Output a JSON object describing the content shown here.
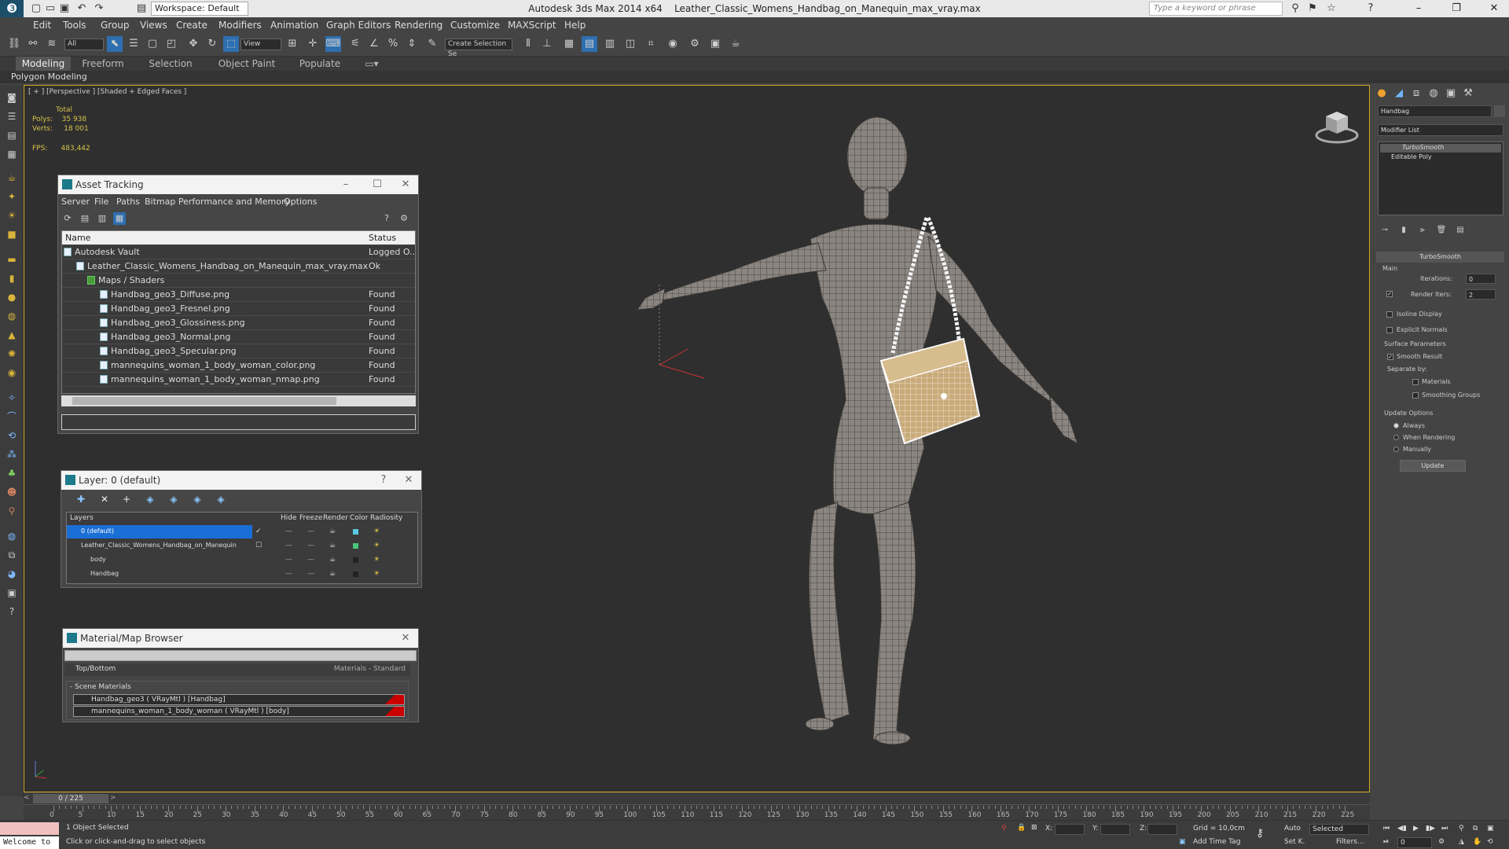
{
  "window": {
    "app_title": "Autodesk 3ds Max  2014 x64",
    "file_title": "Leather_Classic_Womens_Handbag_on_Manequin_max_vray.max",
    "workspace": "Workspace: Default",
    "search_placeholder": "Type a keyword or phrase"
  },
  "menubar": [
    "Edit",
    "Tools",
    "Group",
    "Views",
    "Create",
    "Modifiers",
    "Animation",
    "Graph Editors",
    "Rendering",
    "Customize",
    "MAXScript",
    "Help"
  ],
  "toolbar": {
    "selection_filter": "All",
    "ref_coord": "View",
    "named_selection": "Create Selection Se"
  },
  "ribbon": {
    "tabs": [
      "Modeling",
      "Freeform",
      "Selection",
      "Object Paint",
      "Populate"
    ],
    "sub_label": "Polygon Modeling"
  },
  "viewport": {
    "label": "[ + ] [Perspective ] [Shaded + Edged Faces ]",
    "stats_total": "Total",
    "polys_label": "Polys:",
    "polys_value": "35 938",
    "verts_label": "Verts:",
    "verts_value": "18 001",
    "fps_label": "FPS:",
    "fps_value": "483,442"
  },
  "asset_tracking": {
    "title": "Asset Tracking",
    "menu": [
      "Server",
      "File",
      "Paths",
      "Bitmap Performance and Memory",
      "Options"
    ],
    "col_name": "Name",
    "col_status": "Status",
    "rows": [
      {
        "name": "Autodesk Vault",
        "status": "Logged O..."
      },
      {
        "name": "Leather_Classic_Womens_Handbag_on_Manequin_max_vray.max",
        "status": "Ok"
      },
      {
        "name": "Maps / Shaders",
        "status": ""
      },
      {
        "name": "Handbag_geo3_Diffuse.png",
        "status": "Found"
      },
      {
        "name": "Handbag_geo3_Fresnel.png",
        "status": "Found"
      },
      {
        "name": "Handbag_geo3_Glossiness.png",
        "status": "Found"
      },
      {
        "name": "Handbag_geo3_Normal.png",
        "status": "Found"
      },
      {
        "name": "Handbag_geo3_Specular.png",
        "status": "Found"
      },
      {
        "name": "mannequins_woman_1_body_woman_color.png",
        "status": "Found"
      },
      {
        "name": "mannequins_woman_1_body_woman_nmap.png",
        "status": "Found"
      }
    ]
  },
  "layer_panel": {
    "title": "Layer: 0 (default)",
    "cols": [
      "Layers",
      "Hide",
      "Freeze",
      "Render",
      "Color",
      "Radiosity"
    ],
    "rows": [
      {
        "name": "0 (default)"
      },
      {
        "name": "Leather_Classic_Womens_Handbag_on_Manequin"
      },
      {
        "name": "body"
      },
      {
        "name": "Handbag"
      }
    ]
  },
  "material_browser": {
    "title": "Material/Map Browser",
    "top_bottom": "Top/Bottom",
    "materials_standard": "Materials - Standard",
    "scene_materials": "- Scene Materials",
    "items": [
      "Handbag_geo3  ( VRayMtl )  [Handbag]",
      "mannequins_woman_1_body_woman  ( VRayMtl )  [body]"
    ]
  },
  "command_panel": {
    "object_name": "Handbag",
    "modifier_list": "Modifier List",
    "stack": [
      "TurboSmooth",
      "Editable Poly"
    ],
    "rollout_title": "TurboSmooth",
    "main": "Main",
    "iterations_label": "Iterations:",
    "iterations_value": "0",
    "render_iters_label": "Render Iters:",
    "render_iters_value": "2",
    "isoline": "Isoline Display",
    "explicit_normals": "Explicit Normals",
    "surface_params": "Surface Parameters",
    "smooth_result": "Smooth Result",
    "separate_by": "Separate by:",
    "materials": "Materials",
    "smoothing_groups": "Smoothing Groups",
    "update_options": "Update Options",
    "always": "Always",
    "when_rendering": "When Rendering",
    "manually": "Manually",
    "update_button": "Update"
  },
  "timeline": {
    "frame_display": "0 / 225",
    "ticks": [
      "0",
      "5",
      "10",
      "15",
      "20",
      "25",
      "30",
      "35",
      "40",
      "45",
      "50",
      "55",
      "60",
      "65",
      "70",
      "75",
      "80",
      "85",
      "90",
      "95",
      "100",
      "105",
      "110",
      "115",
      "120",
      "125",
      "130",
      "135",
      "140",
      "145",
      "150",
      "155",
      "160",
      "165",
      "170",
      "175",
      "180",
      "185",
      "190",
      "195",
      "200",
      "205",
      "210",
      "215",
      "220",
      "225"
    ]
  },
  "status": {
    "welcome": "Welcome to",
    "selected": "1 Object Selected",
    "prompt": "Click or click-and-drag to select objects",
    "x_label": "X:",
    "y_label": "Y:",
    "z_label": "Z:",
    "grid": "Grid = 10,0cm",
    "auto": "Auto",
    "selected_dropdown": "Selected",
    "set_key": "Set K.",
    "filters": "Filters...",
    "add_time_tag": "Add Time Tag",
    "frame_field": "0"
  },
  "colors": {
    "viewport_border": "#d6a820",
    "stats_text": "#d6c34a",
    "selection_blue": "#1a6fd6",
    "handbag": "#c9aa7a"
  }
}
